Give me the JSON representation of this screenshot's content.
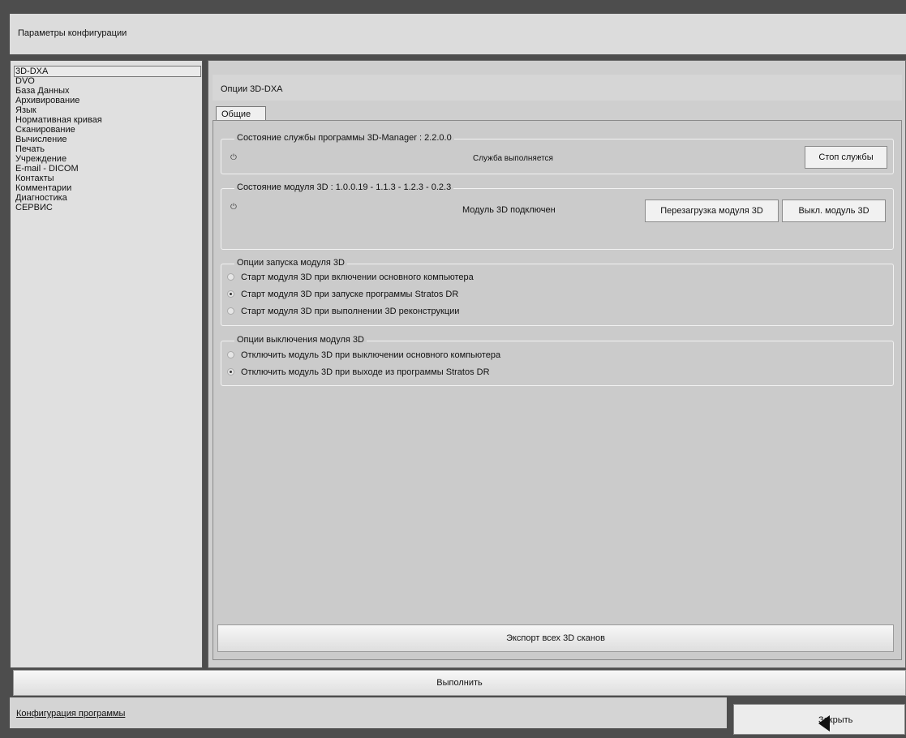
{
  "window": {
    "title": "Параметры конфигурации"
  },
  "sidebar": {
    "items": [
      {
        "label": "3D-DXA",
        "selected": true
      },
      {
        "label": "DVO"
      },
      {
        "label": "База Данных"
      },
      {
        "label": "Архивирование"
      },
      {
        "label": "Язык"
      },
      {
        "label": "Нормативная кривая"
      },
      {
        "label": "Сканирование"
      },
      {
        "label": "Вычисление"
      },
      {
        "label": "Печать"
      },
      {
        "label": "Учреждение"
      },
      {
        "label": "E-mail - DICOM"
      },
      {
        "label": "Контакты"
      },
      {
        "label": "Комментарии"
      },
      {
        "label": "Диагностика"
      },
      {
        "label": "СЕРВИС"
      }
    ]
  },
  "main": {
    "header": "Опции 3D-DXA",
    "tab": "Общие",
    "service_group": {
      "title": "Состояние службы программы 3D-Manager : 2.2.0.0",
      "status": "Служба выполняется",
      "stop_button": "Стоп службы"
    },
    "module_group": {
      "title": "Состояние модуля 3D : 1.0.0.19 - 1.1.3 - 1.2.3 - 0.2.3",
      "status": "Модуль 3D подключен",
      "restart_button": "Перезагрузка модуля 3D",
      "off_button": "Выкл. модуль 3D"
    },
    "start_group": {
      "title": "Опции запуска модуля 3D",
      "options": [
        {
          "label": "Старт модуля 3D при включении основного компьютера",
          "selected": false
        },
        {
          "label": "Старт модуля 3D при запуске программы Stratos DR",
          "selected": true
        },
        {
          "label": "Старт модуля 3D при выполнении 3D реконструкции",
          "selected": false
        }
      ]
    },
    "stop_group": {
      "title": "Опции выключения модуля 3D",
      "options": [
        {
          "label": "Отключить модуль 3D при выключении основного компьютера",
          "selected": false
        },
        {
          "label": "Отключить модуль 3D при выходе из программы Stratos DR",
          "selected": true
        }
      ]
    },
    "export_button": "Экспорт всех 3D сканов"
  },
  "execute_button": "Выполнить",
  "footer": {
    "link": "Конфигурация программы",
    "close_button": "Закрыть"
  }
}
